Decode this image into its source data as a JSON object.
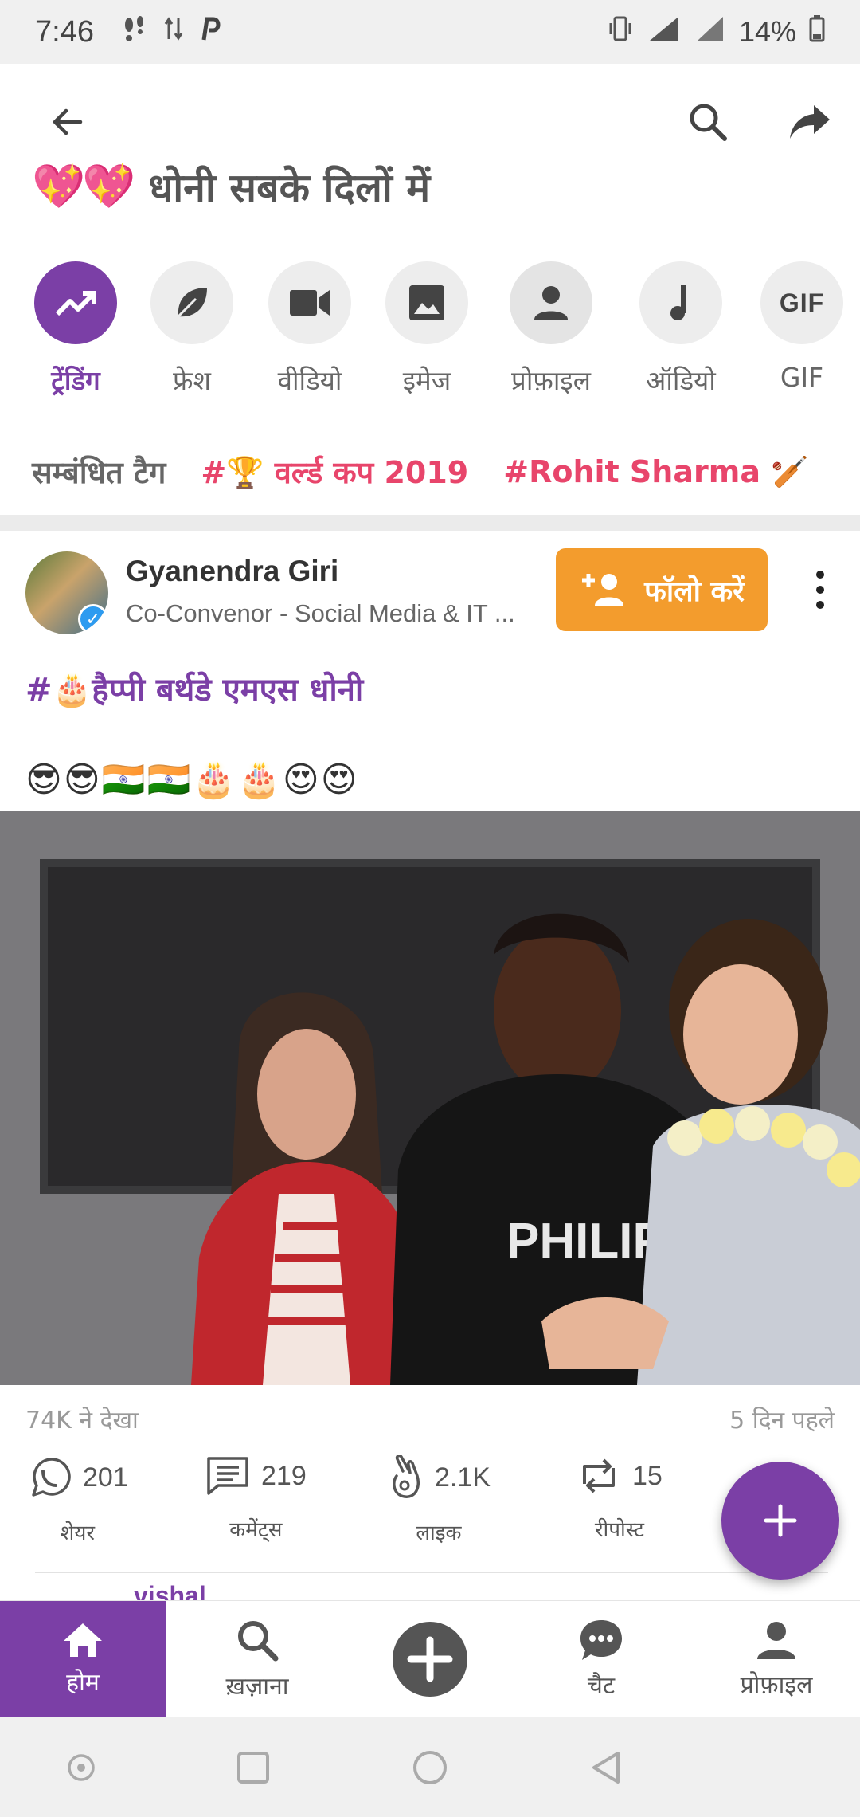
{
  "status_bar": {
    "time": "7:46",
    "battery": "14%"
  },
  "header": {
    "title": "धोनी सबके दिलों में",
    "hearts": "💖💖"
  },
  "categories": [
    {
      "label": "ट्रेंडिंग",
      "icon": "trending-icon",
      "active": true
    },
    {
      "label": "फ्रेश",
      "icon": "leaf-icon",
      "active": false
    },
    {
      "label": "वीडियो",
      "icon": "video-icon",
      "active": false
    },
    {
      "label": "इमेज",
      "icon": "image-icon",
      "active": false
    },
    {
      "label": "प्रोफ़ाइल",
      "icon": "person-icon",
      "active": false
    },
    {
      "label": "ऑडियो",
      "icon": "music-note-icon",
      "active": false
    },
    {
      "label": "GIF",
      "icon": "gif-icon",
      "active": false
    }
  ],
  "related_tags": {
    "label": "सम्बंधित टैग",
    "tags": [
      "#🏆 वर्ल्ड कप 2019",
      "#Rohit Sharma 🏏"
    ]
  },
  "post": {
    "user_name": "Gyanendra Giri",
    "user_role": "Co-Convenor - Social Media & IT ...",
    "follow_label": "फॉलो करें",
    "hashtag": "#🎂हैप्पी बर्थडे एमएस धोनी",
    "emojis": "😎😎🇮🇳🇮🇳🎂🎂😍😍",
    "overlay_text": "PHILIP",
    "views": "74K ने देखा",
    "time_ago": "5 दिन पहले",
    "actions": [
      {
        "count": "201",
        "label": "शेयर",
        "icon": "whatsapp-icon"
      },
      {
        "count": "219",
        "label": "कमेंट्स",
        "icon": "comment-icon"
      },
      {
        "count": "2.1K",
        "label": "लाइक",
        "icon": "like-hand-icon"
      },
      {
        "count": "15",
        "label": "रीपोस्ट",
        "icon": "repost-icon"
      }
    ]
  },
  "next_post_user": "vishal",
  "bottom_nav": [
    {
      "label": "होम",
      "icon": "home-icon",
      "active": true
    },
    {
      "label": "ख़ज़ाना",
      "icon": "search-icon",
      "active": false
    },
    {
      "label": "",
      "icon": "add-circle-icon",
      "active": false
    },
    {
      "label": "चैट",
      "icon": "chat-icon",
      "active": false
    },
    {
      "label": "प्रोफ़ाइल",
      "icon": "person-icon",
      "active": false
    }
  ],
  "colors": {
    "accent": "#7b3fa6",
    "follow": "#f39c2d",
    "tag": "#e8456b"
  }
}
